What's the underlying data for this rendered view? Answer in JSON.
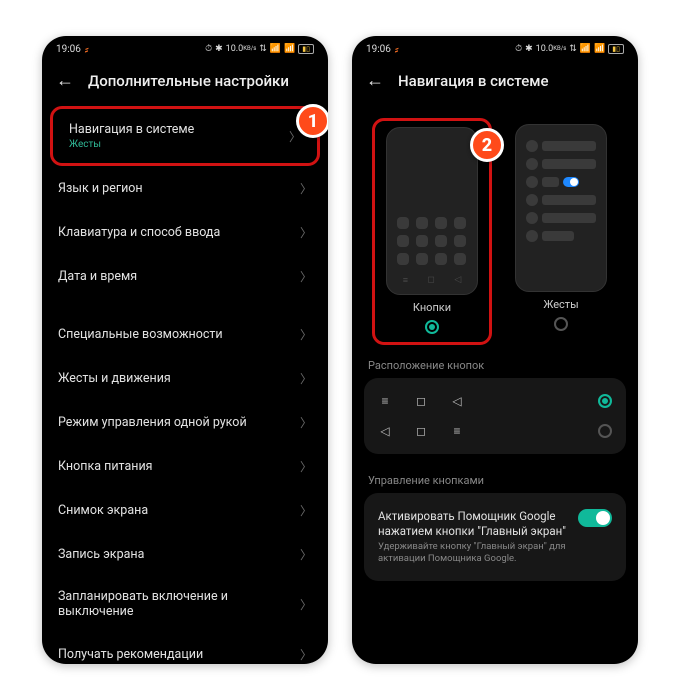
{
  "status": {
    "time": "19:06",
    "icons": "⏰ ✱ 10.0 KB/s ⇅ 📶 ⚡",
    "net": "10.0",
    "netUnit": "KB/s"
  },
  "badges": {
    "one": "1",
    "two": "2"
  },
  "screen1": {
    "title": "Дополнительные настройки",
    "items": {
      "navSystem": {
        "label": "Навигация в системе",
        "sub": "Жесты"
      },
      "langRegion": "Язык и регион",
      "keyboard": "Клавиатура и способ ввода",
      "dateTime": "Дата и время",
      "accessibility": "Специальные возможности",
      "gestures": "Жесты и движения",
      "oneHand": "Режим управления одной рукой",
      "powerBtn": "Кнопка питания",
      "screenshot": "Снимок экрана",
      "screenRec": "Запись экрана",
      "scheduled": "Запланировать включение и выключение",
      "recommend": "Получать рекомендации"
    }
  },
  "screen2": {
    "title": "Навигация в системе",
    "choices": {
      "buttons": "Кнопки",
      "gestures": "Жесты"
    },
    "layoutSection": "Расположение кнопок",
    "manageSection": "Управление кнопками",
    "assistant": {
      "title": "Активировать Помощник Google нажатием кнопки \"Главный экран\"",
      "sub": "Удерживайте кнопку \"Главный экран\" для активации Помощника Google."
    }
  }
}
